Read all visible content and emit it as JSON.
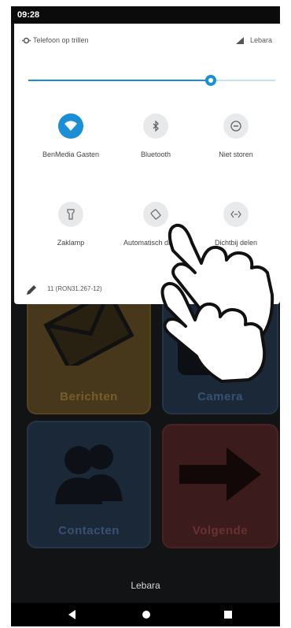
{
  "status": {
    "time": "09:28"
  },
  "quick_settings": {
    "ring_mode": "Telefoon op trillen",
    "carrier": "Lebara",
    "brightness": 0.74,
    "tiles": [
      {
        "icon": "wifi-icon",
        "label": "BenMedia Gasten",
        "active": true
      },
      {
        "icon": "bluetooth-icon",
        "label": "Bluetooth",
        "active": false
      },
      {
        "icon": "do-not-disturb-icon",
        "label": "Niet storen",
        "active": false
      },
      {
        "icon": "flashlight-icon",
        "label": "Zaklamp",
        "active": false
      },
      {
        "icon": "auto-rotate-icon",
        "label": "Automatisch draaien",
        "active": false
      },
      {
        "icon": "nearby-share-icon",
        "label": "Dichtbij delen",
        "active": false
      }
    ],
    "build": "11 (RON31.267-12)"
  },
  "launcher": {
    "tiles": [
      {
        "label": "Berichten",
        "color": "#4a3a1d"
      },
      {
        "label": "Camera",
        "color": "#1c2a3a"
      },
      {
        "label": "Contacten",
        "color": "#1c2a3a"
      },
      {
        "label": "Volgende",
        "color": "#3e1c1c"
      }
    ],
    "carrier": "Lebara"
  },
  "colors": {
    "accent": "#1a8fd6"
  }
}
